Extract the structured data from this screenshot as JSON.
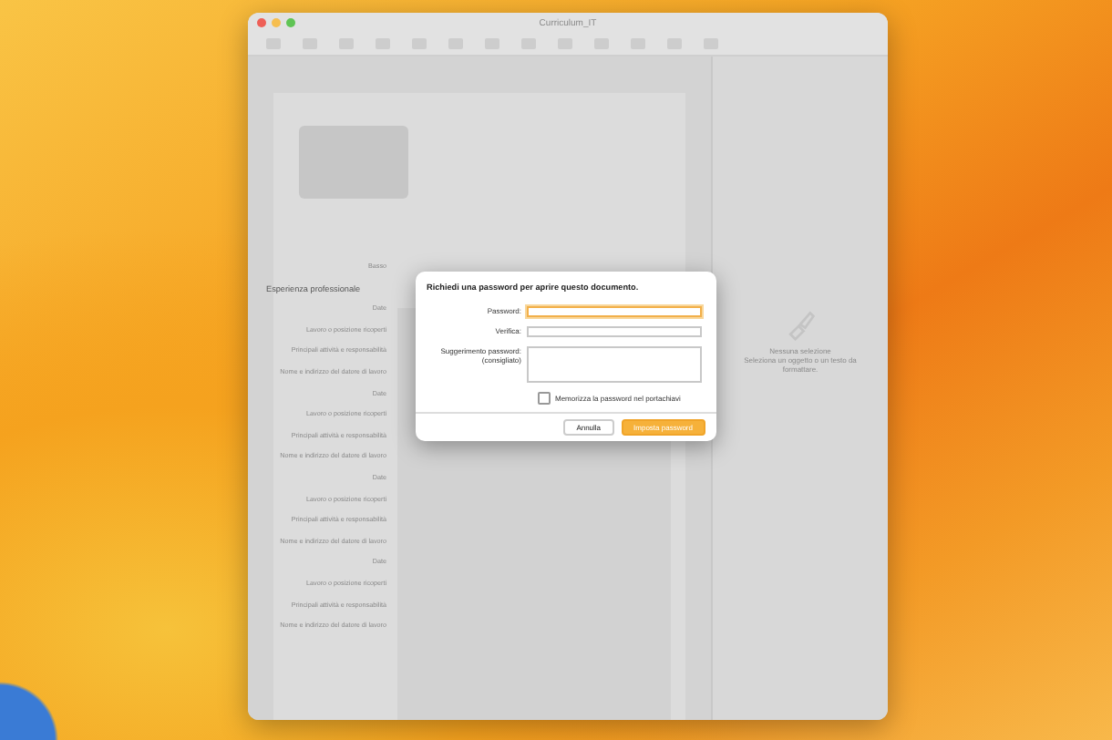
{
  "window": {
    "title": "Curriculum_IT"
  },
  "document": {
    "labels": [
      {
        "text": "Basso",
        "kind": "field"
      },
      {
        "text": "Esperienza professionale",
        "kind": "heading"
      },
      {
        "text": "Date",
        "kind": "field"
      },
      {
        "text": "Lavoro o posizione ricoperti",
        "kind": "field"
      },
      {
        "text": "Principali attività e responsabilità",
        "kind": "field"
      },
      {
        "text": "Nome e indirizzo del datore di lavoro",
        "kind": "field"
      },
      {
        "text": "Date",
        "kind": "field"
      },
      {
        "text": "Lavoro o posizione ricoperti",
        "kind": "field"
      },
      {
        "text": "Principali attività e responsabilità",
        "kind": "field"
      },
      {
        "text": "Nome e indirizzo del datore di lavoro",
        "kind": "field"
      },
      {
        "text": "Date",
        "kind": "field"
      },
      {
        "text": "Lavoro o posizione ricoperti",
        "kind": "field"
      },
      {
        "text": "Principali attività e responsabilità",
        "kind": "field"
      },
      {
        "text": "Nome e indirizzo del datore di lavoro",
        "kind": "field"
      },
      {
        "text": "Date",
        "kind": "field"
      },
      {
        "text": "Lavoro o posizione ricoperti",
        "kind": "field"
      },
      {
        "text": "Principali attività e responsabilità",
        "kind": "field"
      },
      {
        "text": "Nome e indirizzo del datore di lavoro",
        "kind": "field"
      }
    ]
  },
  "inspector": {
    "title": "Nessuna selezione",
    "hint": "Seleziona un oggetto o un testo da formattare."
  },
  "dialog": {
    "title": "Richiedi una password per aprire questo documento.",
    "fields": [
      {
        "label": "Password:",
        "kind": "line",
        "focused": true
      },
      {
        "label": "Verifica:",
        "kind": "line",
        "focused": false
      },
      {
        "label": "Suggerimento password:\n(consigliato)",
        "kind": "area",
        "focused": false
      }
    ],
    "checkbox": {
      "label": "Memorizza la password nel portachiavi",
      "checked": false
    },
    "buttons": [
      {
        "label": "Annulla",
        "kind": "secondary"
      },
      {
        "label": "Imposta password",
        "kind": "primary"
      }
    ]
  }
}
